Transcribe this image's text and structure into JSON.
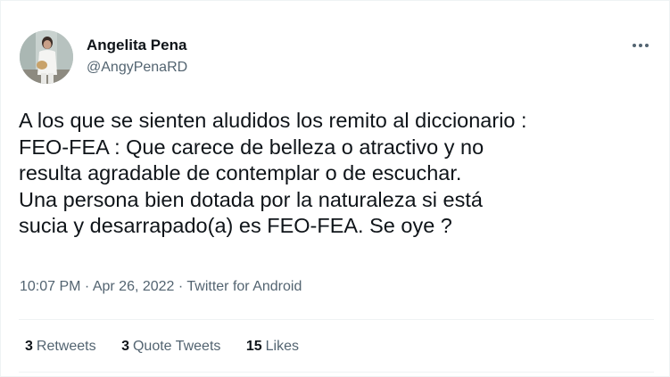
{
  "author": {
    "name": "Angelita Pena",
    "handle": "@AngyPenaRD",
    "avatar_icon": "profile-photo"
  },
  "menu": {
    "icon": "more-horizontal-icon"
  },
  "tweet": {
    "text": "A los que se sienten aludidos los remito al diccionario :\nFEO-FEA : Que carece de belleza o atractivo y no\nresulta agradable de contemplar o de escuchar.\nUna persona bien dotada por la naturaleza si está\nsucia y desarrapado(a) es FEO-FEA. Se oye  ?"
  },
  "meta": {
    "time": "10:07 PM",
    "dot1": " · ",
    "date": "Apr 26, 2022",
    "dot2": " · ",
    "source": "Twitter for Android"
  },
  "stats": {
    "retweets_count": "3",
    "retweets_label": "Retweets",
    "quotes_count": "3",
    "quotes_label": "Quote Tweets",
    "likes_count": "15",
    "likes_label": "Likes"
  },
  "colors": {
    "text_primary": "#0f1419",
    "text_secondary": "#536471",
    "divider": "#eff3f4"
  }
}
